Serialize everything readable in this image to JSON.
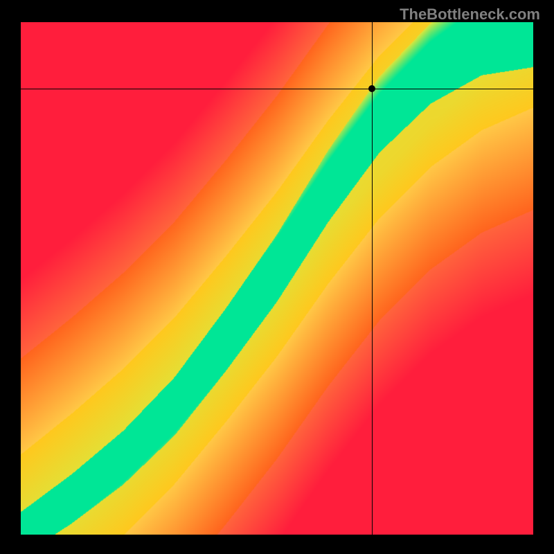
{
  "watermark": "TheBottleneck.com",
  "chart_data": {
    "type": "heatmap",
    "title": "",
    "xlabel": "",
    "ylabel": "",
    "xlim": [
      0,
      1
    ],
    "ylim": [
      0,
      1
    ],
    "crosshair": {
      "x": 0.685,
      "y": 0.87
    },
    "marker": {
      "x": 0.685,
      "y": 0.87
    },
    "colorscale_description": "red (low) through orange, yellow to green (optimal ridge) back down to yellow/orange/red; green ridge follows a superlinear curve from bottom-left to top-right",
    "ridge_points": [
      {
        "x": 0.0,
        "y": 0.0
      },
      {
        "x": 0.1,
        "y": 0.07
      },
      {
        "x": 0.2,
        "y": 0.15
      },
      {
        "x": 0.3,
        "y": 0.25
      },
      {
        "x": 0.4,
        "y": 0.38
      },
      {
        "x": 0.5,
        "y": 0.52
      },
      {
        "x": 0.6,
        "y": 0.68
      },
      {
        "x": 0.7,
        "y": 0.82
      },
      {
        "x": 0.8,
        "y": 0.92
      },
      {
        "x": 0.9,
        "y": 0.98
      },
      {
        "x": 1.0,
        "y": 1.0
      }
    ]
  }
}
